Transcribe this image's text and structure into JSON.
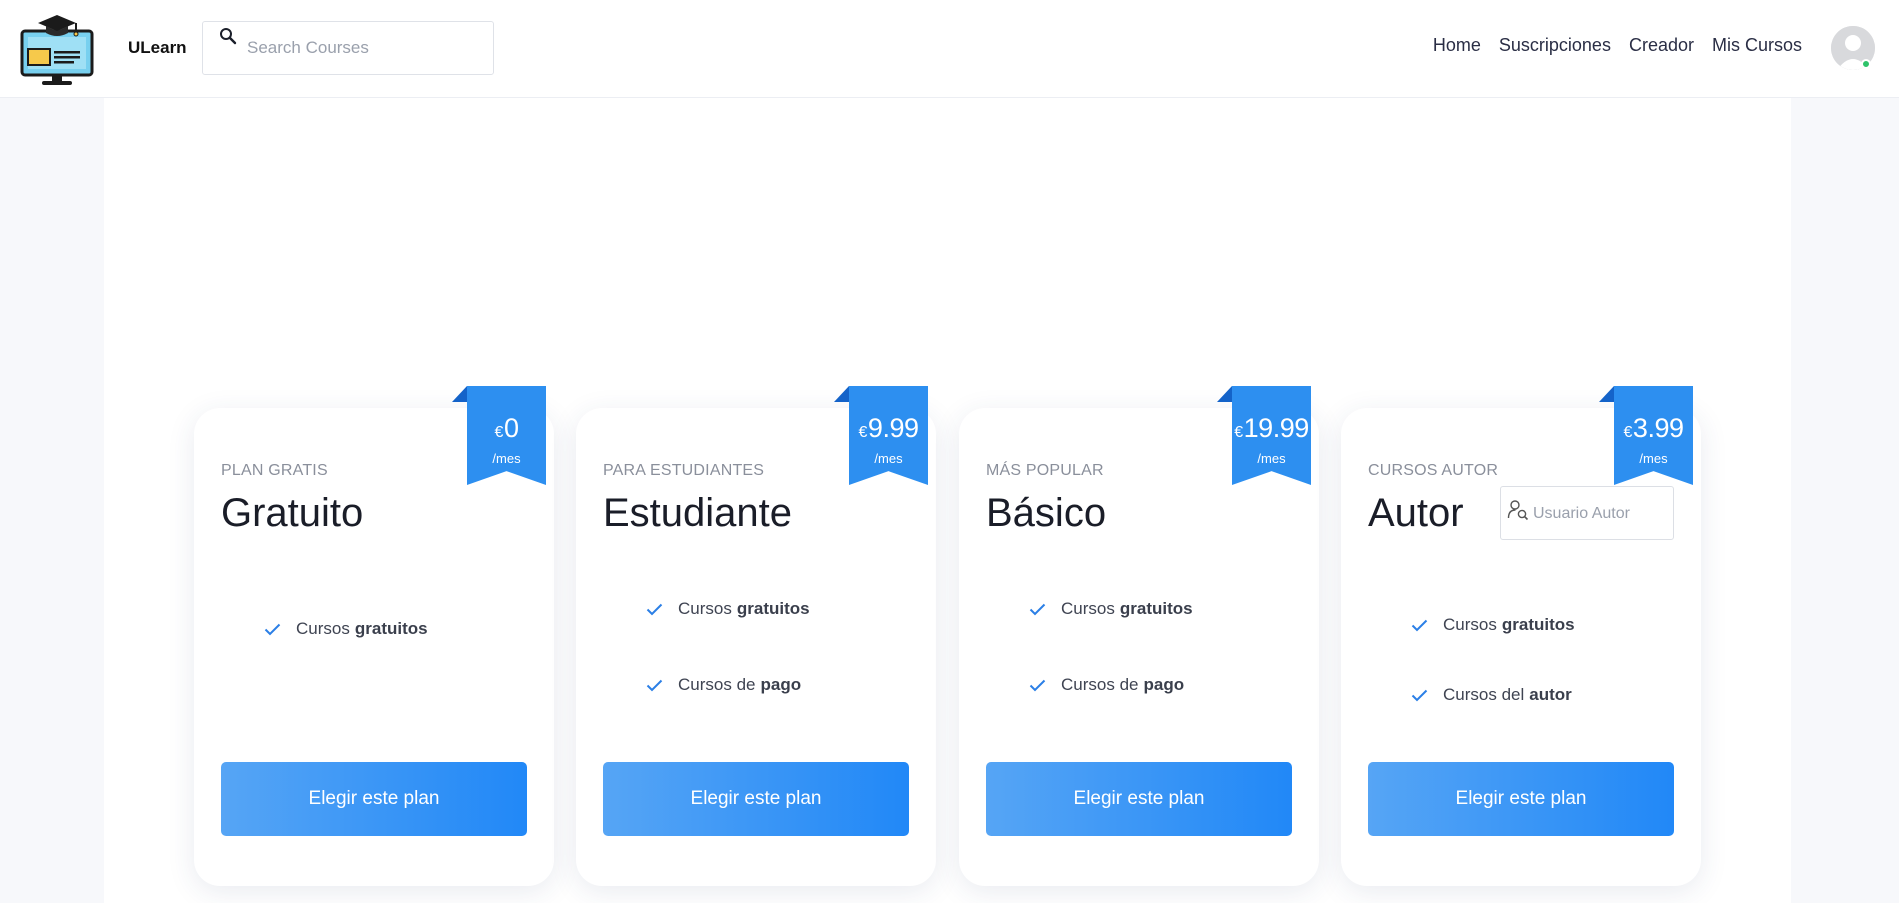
{
  "header": {
    "brand": "ULearn",
    "search_placeholder": "Search Courses",
    "nav": [
      "Home",
      "Suscripciones",
      "Creador",
      "Mis Cursos"
    ]
  },
  "colors": {
    "accent": "#2d8ff0",
    "button_start": "#56a5f5",
    "button_end": "#2188f7",
    "check": "#2b7fe6",
    "online": "#2ec36a"
  },
  "plans": [
    {
      "eyebrow": "PLAN GRATIS",
      "title": "Gratuito",
      "currency": "€",
      "price": "0",
      "per": "/mes",
      "features": [
        {
          "text": "Cursos",
          "strong": "gratuitos"
        }
      ],
      "button": "Elegir este plan"
    },
    {
      "eyebrow": "PARA ESTUDIANTES",
      "title": "Estudiante",
      "currency": "€",
      "price": "9.99",
      "per": "/mes",
      "features": [
        {
          "text": "Cursos",
          "strong": "gratuitos"
        },
        {
          "text": "Cursos de",
          "strong": "pago"
        }
      ],
      "button": "Elegir este plan"
    },
    {
      "eyebrow": "MÁS POPULAR",
      "title": "Básico",
      "currency": "€",
      "price": "19.99",
      "per": "/mes",
      "features": [
        {
          "text": "Cursos",
          "strong": "gratuitos"
        },
        {
          "text": "Cursos de",
          "strong": "pago"
        }
      ],
      "button": "Elegir este plan"
    },
    {
      "eyebrow": "CURSOS AUTOR",
      "title": "Autor",
      "currency": "€",
      "price": "3.99",
      "per": "/mes",
      "author_placeholder": "Usuario Autor",
      "features": [
        {
          "text": "Cursos",
          "strong": "gratuitos"
        },
        {
          "text": "Cursos del",
          "strong": "autor"
        }
      ],
      "button": "Elegir este plan"
    }
  ]
}
